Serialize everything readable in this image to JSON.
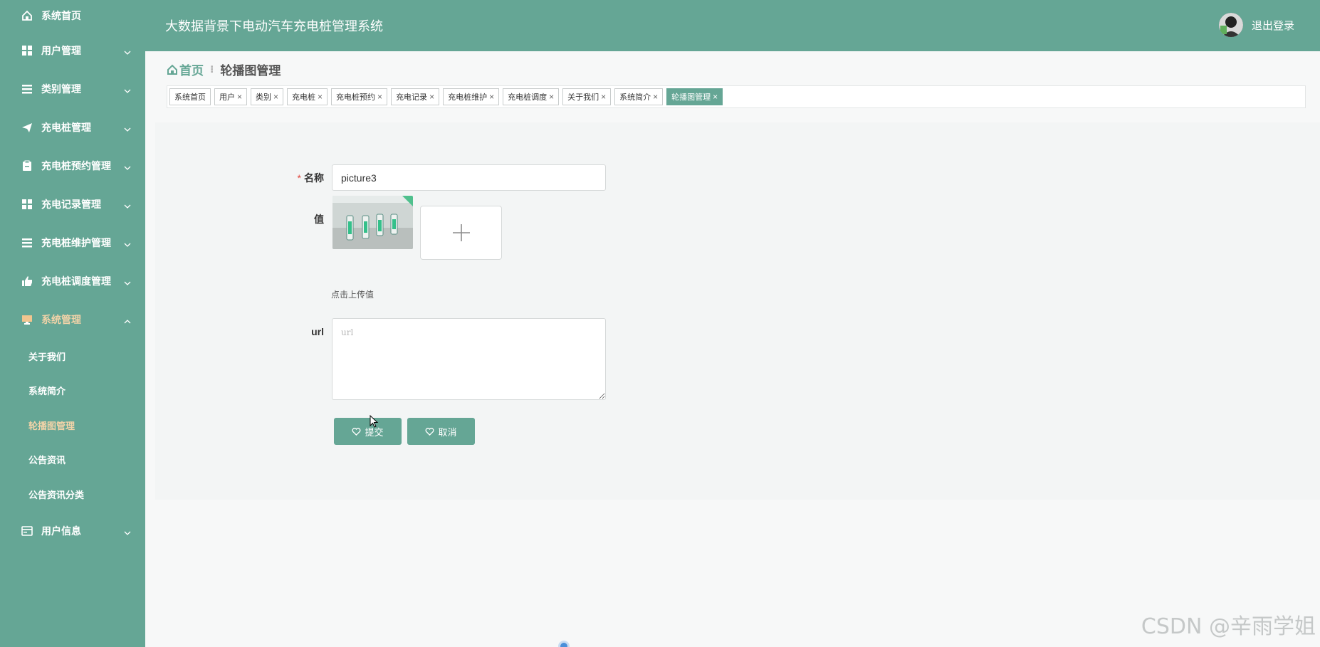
{
  "app": {
    "title": "大数据背景下电动汽车充电桩管理系统",
    "logout_label": "退出登录",
    "accent_color": "#65a695"
  },
  "sidebar": {
    "items": [
      {
        "label": "系统首页",
        "icon": "home-icon"
      },
      {
        "label": "用户管理",
        "icon": "grid-icon"
      },
      {
        "label": "类别管理",
        "icon": "list-icon"
      },
      {
        "label": "充电桩管理",
        "icon": "send-icon"
      },
      {
        "label": "充电桩预约管理",
        "icon": "clipboard-icon"
      },
      {
        "label": "充电记录管理",
        "icon": "grid-icon"
      },
      {
        "label": "充电桩维护管理",
        "icon": "list-icon"
      },
      {
        "label": "充电桩调度管理",
        "icon": "thumb-icon"
      },
      {
        "label": "系统管理",
        "icon": "monitor-icon"
      },
      {
        "label": "用户信息",
        "icon": "card-icon"
      }
    ],
    "sub_items": [
      "关于我们",
      "系统简介",
      "轮播图管理",
      "公告资讯",
      "公告资讯分类"
    ]
  },
  "breadcrumb": {
    "home": "首页",
    "separator": "⁝",
    "current": "轮播图管理"
  },
  "tags": [
    {
      "label": "系统首页",
      "closable": false
    },
    {
      "label": "用户",
      "closable": true
    },
    {
      "label": "类别",
      "closable": true
    },
    {
      "label": "充电桩",
      "closable": true
    },
    {
      "label": "充电桩预约",
      "closable": true
    },
    {
      "label": "充电记录",
      "closable": true
    },
    {
      "label": "充电桩维护",
      "closable": true
    },
    {
      "label": "充电桩调度",
      "closable": true
    },
    {
      "label": "关于我们",
      "closable": true
    },
    {
      "label": "系统简介",
      "closable": true
    },
    {
      "label": "轮播图管理",
      "closable": true,
      "active": true
    }
  ],
  "form": {
    "name_label": "名称",
    "required_mark": "*",
    "name_value": "picture3",
    "value_label": "值",
    "upload_hint": "点击上传值",
    "url_label": "url",
    "url_placeholder": "url",
    "submit_label": "提交",
    "cancel_label": "取消"
  },
  "watermark": "CSDN @辛雨学姐"
}
